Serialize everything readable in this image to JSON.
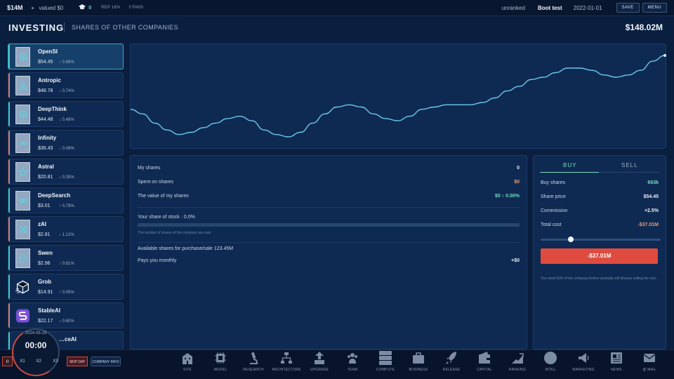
{
  "topbar": {
    "money": "$14M",
    "valued": "valued $0",
    "cap_count": "0",
    "rep": "REP 16%",
    "fans": "0 FANS",
    "rank": "unranked",
    "company": "Boot test",
    "date": "2022-01-01",
    "save_label": "SAVE",
    "menu_label": "MENU"
  },
  "header": {
    "title": "INVESTING",
    "subtitle": "SHARES OF OTHER COMPANIES",
    "total": "$148.02M"
  },
  "companies": [
    {
      "name": "OpenSI",
      "price": "$54.45",
      "change": "↑ 0.99%",
      "edge": "#3fc9c0",
      "icon": "openai-logo-icon"
    },
    {
      "name": "Antropic",
      "price": "$48.78",
      "change": "↓ 0.74%",
      "edge": "#d97a6a",
      "icon": "anthropic-logo-icon"
    },
    {
      "name": "DeepThink",
      "price": "$44.48",
      "change": "↓ 0.48%",
      "edge": "#3fc9c0",
      "icon": "brain-logo-icon"
    },
    {
      "name": "Infinity",
      "price": "$36.43",
      "change": "↓ 0.09%",
      "edge": "#d97a6a",
      "icon": "infinity-logo-icon"
    },
    {
      "name": "Astral",
      "price": "$20.81",
      "change": "↓ 0.35%",
      "edge": "#d97a6a",
      "icon": "star-logo-icon"
    },
    {
      "name": "DeepSearch",
      "price": "$3.01",
      "change": "↑ 0.79%",
      "edge": "#3fc9c0",
      "icon": "eye-logo-icon"
    },
    {
      "name": "zAI",
      "price": "$2.81",
      "change": "↓ 1.12%",
      "edge": "#d97a6a",
      "icon": "cross-logo-icon"
    },
    {
      "name": "Swen",
      "price": "$2.96",
      "change": "↑ 0.81%",
      "edge": "#3fc9c0",
      "icon": "diamond-logo-icon"
    },
    {
      "name": "Grob",
      "price": "$14.91",
      "change": "↑ 0.05%",
      "edge": "#3fc9c0",
      "icon": "cube-logo-icon"
    },
    {
      "name": "StableAI",
      "price": "$22.17",
      "change": "↓ 0.60%",
      "edge": "#d97a6a",
      "icon": "s-logo-icon"
    },
    {
      "name": "…ceAI",
      "price": "",
      "change": "",
      "edge": "#3fc9c0",
      "icon": "partial-logo-icon"
    }
  ],
  "chart_data": {
    "type": "line",
    "title": "",
    "xlabel": "",
    "ylabel": "",
    "grid": false,
    "series": [
      {
        "values": [
          52.1,
          51.9,
          51.5,
          51.2,
          51.0,
          51.1,
          51.3,
          51.5,
          51.7,
          51.8,
          51.6,
          51.2,
          51.0,
          50.9,
          51.1,
          51.5,
          51.9,
          52.2,
          52.3,
          52.2,
          51.9,
          51.7,
          51.6,
          51.8,
          52.1,
          52.2,
          52.3,
          52.3,
          52.3,
          52.4,
          52.6,
          52.9,
          53.1,
          53.4,
          53.5,
          53.7,
          53.9,
          53.9,
          53.8,
          53.6,
          53.5,
          53.6,
          53.8,
          54.2,
          54.45
        ]
      }
    ],
    "color": "#6cc8ec"
  },
  "holdings": {
    "my_shares_label": "My shares",
    "my_shares_value": "0",
    "spent_label": "Spent on shares",
    "spent_value": "$0",
    "value_label": "The value of my shares",
    "value_value": "$0 ↕ 0.00%",
    "share_label": "Your share of stock · 0.0%",
    "hint": "The number of shares of the company you own",
    "available": "Available shares for purchase/sale 123.45M",
    "monthly_label": "Pays you monthly",
    "monthly_value": "+$0"
  },
  "trade": {
    "buy_tab": "BUY",
    "sell_tab": "SELL",
    "buy_shares_label": "Buy shares",
    "buy_shares_value": "663k",
    "price_label": "Share price",
    "price_value": "$54.45",
    "commission_label": "Commission",
    "commission_value": "+2.5%",
    "total_label": "Total cost",
    "total_value": "-$37.01M",
    "slider_fraction": 0.24,
    "button_label": "-$37.01M",
    "note": "You need 50% of the company before anybody will discuss selling the rest.."
  },
  "bottom": {
    "clock_date": "2024-05-19",
    "clock_time": "00:00",
    "pause": "II",
    "x1": "X1",
    "x2": "X2",
    "x3": "X3",
    "skip": "SKIP DAY",
    "company_info": "COMPANY INFO",
    "nav": [
      "SITE",
      "MODEL",
      "RESEARCH",
      "ARCHITECTURE",
      "UPGRADE",
      "TEAM",
      "COMPUTE",
      "BUSINESS",
      "RELEASE",
      "CAPITAL",
      "RANKING",
      "INTEL",
      "MARKETING",
      "NEWS",
      "@ MAIL"
    ]
  }
}
